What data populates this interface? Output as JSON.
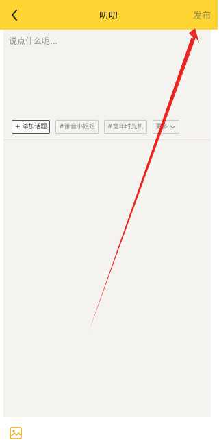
{
  "header": {
    "title": "叨叨",
    "publish_label": "发布",
    "bg_color": "#fdd432"
  },
  "composer": {
    "placeholder": "说点什么呢..."
  },
  "topics": {
    "add_label": "+ 添加话题",
    "items": [
      "#御音小姐姐",
      "#童年时光机"
    ],
    "more_label": "更多"
  },
  "icons": {
    "back": "chevron-left-icon",
    "more": "chevron-down-icon",
    "image": "image-icon"
  },
  "annotation": {
    "arrow_color": "#e8231f"
  }
}
